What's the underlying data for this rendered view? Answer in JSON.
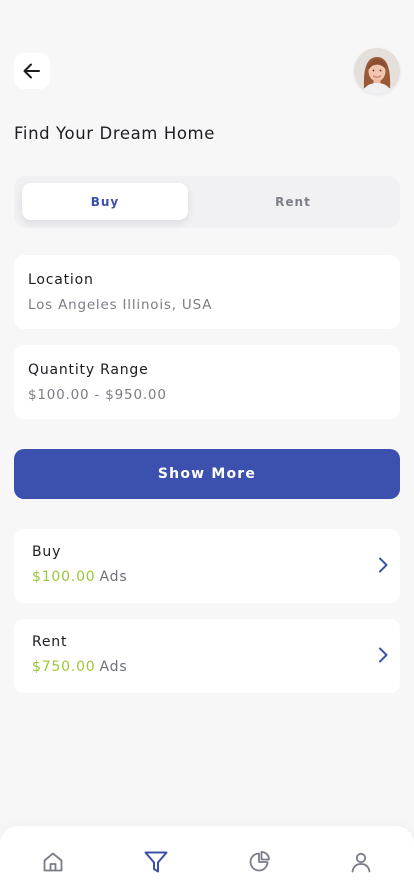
{
  "header": {
    "back_icon": "arrow-left-icon",
    "avatar_icon": "user-avatar"
  },
  "page": {
    "title": "Find Your Dream Home"
  },
  "tabs": {
    "buy_label": "Buy",
    "rent_label": "Rent",
    "selected": "Buy"
  },
  "filters": {
    "location": {
      "label": "Location",
      "value": "Los Angeles Illinois, USA"
    },
    "quantity_range": {
      "label": "Quantity Range",
      "value": "$100.00 - $950.00"
    }
  },
  "actions": {
    "show_more_label": "Show More"
  },
  "ads": [
    {
      "title": "Buy",
      "price": "$100.00",
      "suffix": "Ads"
    },
    {
      "title": "Rent",
      "price": "$750.00",
      "suffix": "Ads"
    }
  ],
  "bottom_nav": {
    "items": [
      "home-icon",
      "filter-icon",
      "pie-chart-icon",
      "profile-icon"
    ],
    "active": "filter-icon"
  },
  "colors": {
    "accent": "#3c51ae",
    "price_green": "#9cc738",
    "background": "#f7f7f8",
    "card": "#ffffff",
    "muted_text": "#7c7d86",
    "nav_icon": "#7a7c88"
  }
}
